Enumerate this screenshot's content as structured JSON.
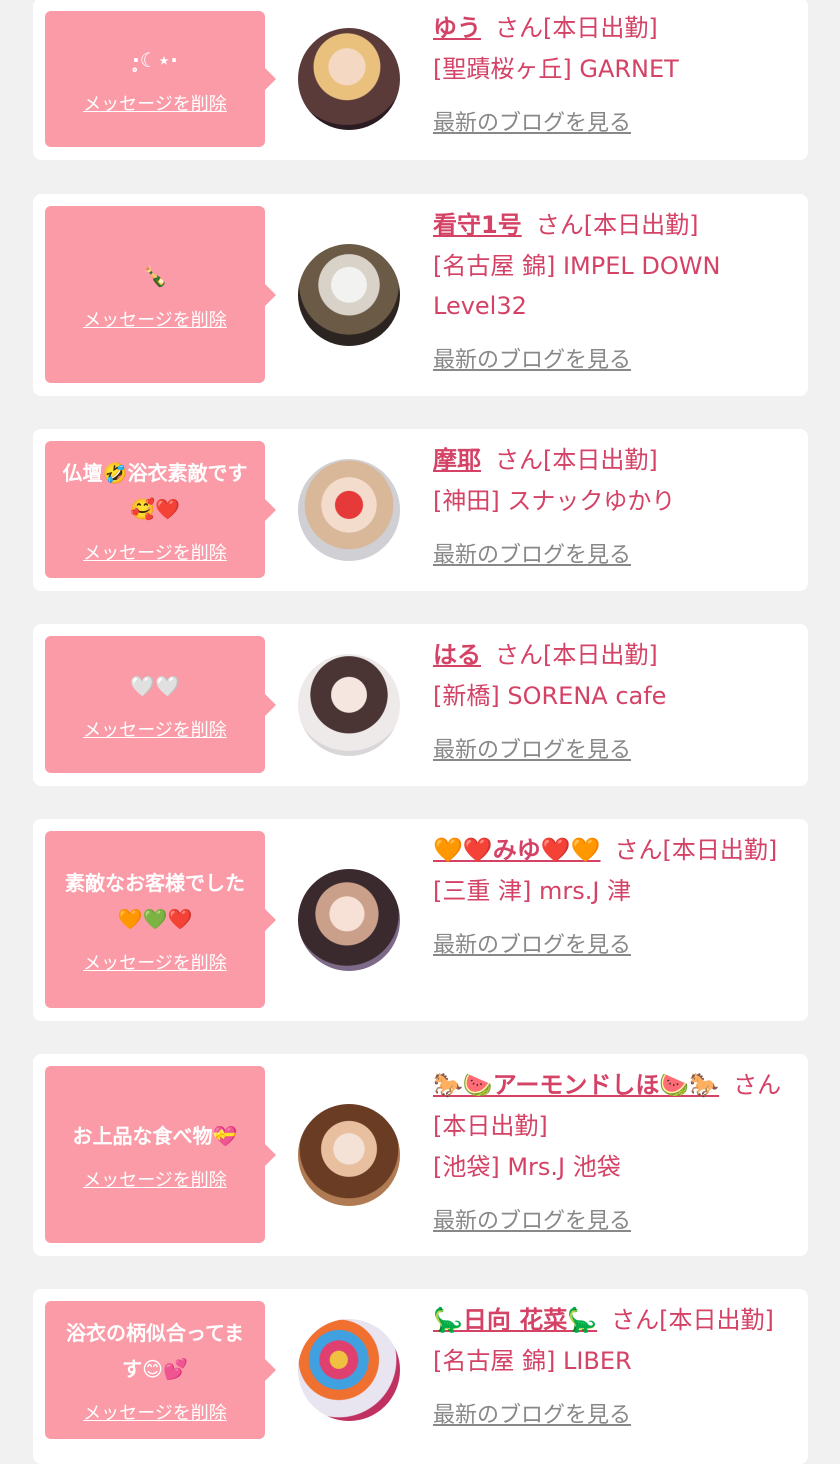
{
  "bookmarks": [
    {
      "message": "̥̥☾⋆̥",
      "message_display": "·̥☾⋆·",
      "delete_label": "メッセージを削除",
      "name": "ゆう",
      "suffix": "さん[本日出勤]",
      "shop": "[聖蹟桜ヶ丘] GARNET",
      "blog_label": "最新のブログを見る"
    },
    {
      "message": "🍾",
      "delete_label": "メッセージを削除",
      "name": "看守1号",
      "suffix": "さん[本日出勤]",
      "shop": "[名古屋 錦] IMPEL DOWN Level32",
      "blog_label": "最新のブログを見る"
    },
    {
      "message": "仏壇🤣浴衣素敵です🥰❤️",
      "delete_label": "メッセージを削除",
      "name": "摩耶",
      "suffix": "さん[本日出勤]",
      "shop": "[神田] スナックゆかり",
      "blog_label": "最新のブログを見る"
    },
    {
      "message": "🤍🤍",
      "delete_label": "メッセージを削除",
      "name": "はる",
      "suffix": "さん[本日出勤]",
      "shop": "[新橋] SORENA cafe",
      "blog_label": "最新のブログを見る"
    },
    {
      "message": "素敵なお客様でした🧡💚❤️",
      "delete_label": "メッセージを削除",
      "name": "🧡❤️みゆ❤️🧡",
      "suffix": "さん[本日出勤]",
      "shop": "[三重 津] mrs.J 津",
      "blog_label": "最新のブログを見る"
    },
    {
      "message": "お上品な食べ物💝",
      "delete_label": "メッセージを削除",
      "name": "🐎🍉アーモンドしほ🍉🐎",
      "suffix": "さん[本日出勤]",
      "shop": "[池袋] Mrs.J 池袋",
      "blog_label": "最新のブログを見る"
    },
    {
      "message": "浴衣の柄似合ってます😊💕",
      "delete_label": "メッセージを削除",
      "name": "🦕日向 花菜🦕",
      "suffix": "さん[本日出勤]",
      "shop": "[名古屋 錦] LIBER",
      "blog_label": "最新のブログを見る"
    }
  ],
  "colors": {
    "page_bg": "#f1f1f1",
    "card_bg": "#ffffff",
    "bubble_bg": "#fb9ba7",
    "accent_text": "#d44266",
    "link_gray": "#888888"
  }
}
